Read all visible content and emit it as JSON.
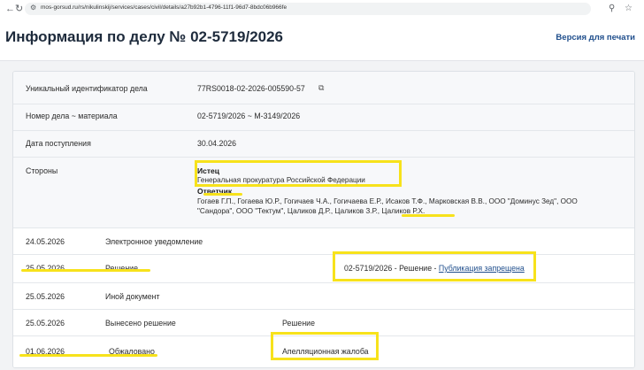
{
  "browser": {
    "url": "mos-gorsud.ru/rs/nikulinskij/services/cases/civil/details/a27b92b1-4796-11f1-96d7-8bdc06b966fe"
  },
  "header": {
    "title": "Информация по делу № 02-5719/2026",
    "print_link": "Версия для печати"
  },
  "case_info": {
    "rows": [
      {
        "label": "Уникальный идентификатор дела",
        "value": "77RS0018-02-2026-005590-57"
      },
      {
        "label": "Номер дела ~ материала",
        "value": "02-5719/2026 ~ М-3149/2026"
      },
      {
        "label": "Дата поступления",
        "value": "30.04.2026"
      }
    ],
    "parties": {
      "label": "Стороны",
      "plaintiff_title": "Истец",
      "plaintiff": "Генеральная прокуратура Российской Федерации",
      "defendant_title": "Ответчик",
      "defendants_line1": "Гогаев Г.П., Гогаева Ю.Р., Гогичаев Ч.А., Гогичаева Е.Р., Исаков Т.Ф., Марковская В.В., ООО \"Доминус Зед\", ООО",
      "defendants_line2": "\"Сандора\", ООО \"Тектум\", Цаликов Д.Р., Цаликов З.Р., Цаликов Р.Х."
    }
  },
  "events": [
    {
      "date": "24.05.2026",
      "type": "Электронное уведомление",
      "extra": ""
    },
    {
      "date": "25.05.2026",
      "type": "Решение",
      "extra": "02-5719/2026 - Решение - ",
      "link": "Публикация запрещена"
    },
    {
      "date": "25.05.2026",
      "type": "Иной документ",
      "extra": ""
    },
    {
      "date": "25.05.2026",
      "type": "Вынесено решение",
      "extra": "Решение"
    },
    {
      "date": "01.06.2026",
      "type": "Обжаловано",
      "extra": "Апелляционная жалоба"
    }
  ],
  "colors": {
    "highlight": "#f7e21b",
    "link": "#1f4e8c"
  }
}
